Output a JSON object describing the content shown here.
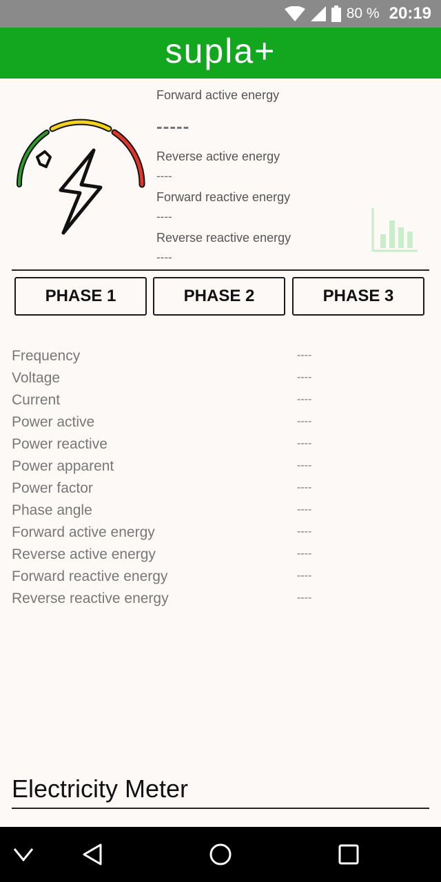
{
  "status_bar": {
    "battery_percent": "80 %",
    "time": "20:19",
    "icons": [
      "wifi-icon",
      "cell-signal-icon",
      "battery-icon"
    ]
  },
  "app_bar": {
    "logo_text": "supla+"
  },
  "summary": {
    "forward_active_label": "Forward active energy",
    "forward_active_value": "-----",
    "reverse_active_label": "Reverse active energy",
    "reverse_active_value": "----",
    "forward_reactive_label": "Forward reactive energy",
    "forward_reactive_value": "----",
    "reverse_reactive_label": "Reverse reactive energy",
    "reverse_reactive_value": "----"
  },
  "tabs": [
    "PHASE 1",
    "PHASE 2",
    "PHASE 3"
  ],
  "params": [
    {
      "label": "Frequency",
      "value": "----"
    },
    {
      "label": "Voltage",
      "value": "----"
    },
    {
      "label": "Current",
      "value": "----"
    },
    {
      "label": "Power active",
      "value": "----"
    },
    {
      "label": "Power reactive",
      "value": "----"
    },
    {
      "label": "Power apparent",
      "value": "----"
    },
    {
      "label": "Power factor",
      "value": "----"
    },
    {
      "label": "Phase angle",
      "value": "----"
    },
    {
      "label": "Forward active energy",
      "value": "----"
    },
    {
      "label": "Reverse active energy",
      "value": "----"
    },
    {
      "label": "Forward reactive energy",
      "value": "----"
    },
    {
      "label": "Reverse reactive energy",
      "value": "----"
    }
  ],
  "footer": {
    "title": "Electricity Meter"
  },
  "colors": {
    "app_bar": "#12a71e",
    "gauge_green": "#2e9e2b",
    "gauge_yellow": "#f2d21b",
    "gauge_red": "#e0352b",
    "chart_icon": "#c9ecc9"
  }
}
